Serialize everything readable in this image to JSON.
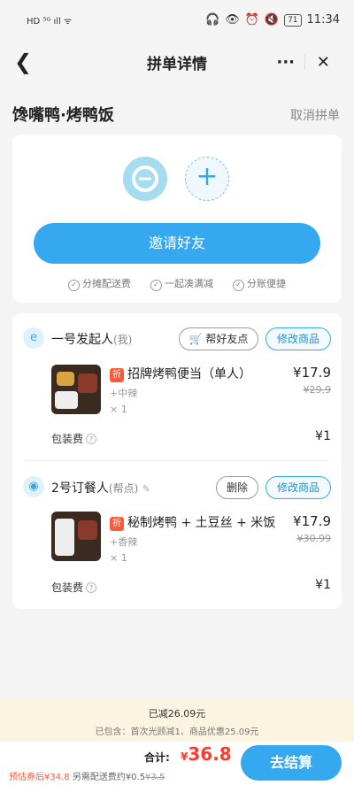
{
  "status_bar": {
    "left": "HD ⁵ᴳ ıll ᯤ",
    "battery": "71",
    "time": "11:34"
  },
  "nav": {
    "title": "拼单详情",
    "more_icon": "more-icon",
    "close_icon": "close-icon"
  },
  "store": {
    "name": "馋嘴鸭·烤鸭饭",
    "cancel_label": "取消拼单"
  },
  "invite": {
    "button_label": "邀请好友",
    "perks": [
      "分摊配送费",
      "一起凑满减",
      "分账便捷"
    ]
  },
  "participants": [
    {
      "name": "一号发起人",
      "role": "(我)",
      "action1": "帮好友点",
      "action2": "修改商品",
      "item": {
        "tag": "折",
        "name": "招牌烤鸭便当（单人）",
        "spec": "+中辣",
        "qty": "× 1",
        "price": "¥17.9",
        "old_price": "¥29.9"
      },
      "pack_label": "包装费",
      "pack_fee": "¥1"
    },
    {
      "name": "2号订餐人",
      "role": "(帮点)",
      "action1": "删除",
      "action2": "修改商品",
      "item": {
        "tag": "折",
        "name": "秘制烤鸭 + 土豆丝 + 米饭",
        "spec": "+香辣",
        "qty": "× 1",
        "price": "¥17.9",
        "old_price": "¥30.99"
      },
      "pack_label": "包装费",
      "pack_fee": "¥1"
    }
  ],
  "summary": {
    "saved": "已减26.09元",
    "detail": "已包含：首次光顾减1、商品优惠25.09元"
  },
  "footer": {
    "total_label": "合计:",
    "total_currency": "¥",
    "total_value": "36.8",
    "coupon_text": "预估券后¥34.8",
    "delivery_text": " 另需配送费约¥0.5",
    "delivery_old": "¥3.5",
    "checkout_label": "去结算"
  },
  "colors": {
    "accent": "#35a8f0",
    "price_red": "#ff3b30",
    "tag": "#ff5a3c",
    "saved_bg": "#fbf4e0"
  }
}
